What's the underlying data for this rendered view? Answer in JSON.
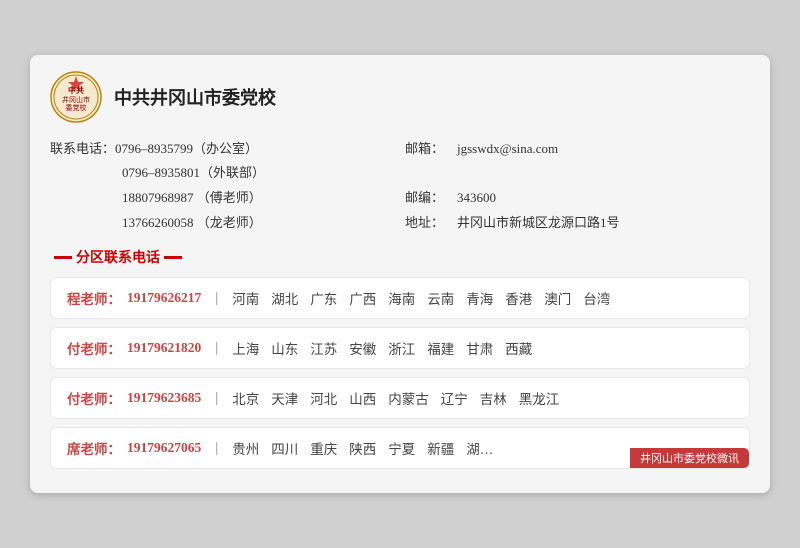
{
  "org": {
    "name": "中共井冈山市委党校",
    "contact_label": "联系电话：",
    "phones": [
      {
        "number": "0796–8935799",
        "note": "（办公室）"
      },
      {
        "number": "0796–8935801",
        "note": "（外联部）"
      },
      {
        "number": "18807968987",
        "note": "（傅老师）"
      },
      {
        "number": "13766260058",
        "note": "（龙老师）"
      }
    ],
    "email_label": "邮箱：",
    "email": "jgsswdx@sina.com",
    "zipcode_label": "邮编：",
    "zipcode": "343600",
    "address_label": "地址：",
    "address": "井冈山市新城区龙源口路1号"
  },
  "section_title": "分区联系电话",
  "regions": [
    {
      "teacher": "程老师：",
      "phone": "19179626217",
      "areas": [
        "河南",
        "湖北",
        "广东",
        "广西",
        "海南",
        "云南",
        "青海",
        "香港",
        "澳门",
        "台湾"
      ]
    },
    {
      "teacher": "付老师：",
      "phone": "19179621820",
      "areas": [
        "上海",
        "山东",
        "江苏",
        "安徽",
        "浙江",
        "福建",
        "甘肃",
        "西藏"
      ]
    },
    {
      "teacher": "付老师：",
      "phone": "19179623685",
      "areas": [
        "北京",
        "天津",
        "河北",
        "山西",
        "内蒙古",
        "辽宁",
        "吉林",
        "黑龙江"
      ]
    },
    {
      "teacher": "席老师：",
      "phone": "19179627065",
      "areas": [
        "贵州",
        "四川",
        "重庆",
        "陕西",
        "宁夏",
        "新疆",
        "湖…"
      ]
    }
  ],
  "watermark": "井冈山市委党校微讯"
}
